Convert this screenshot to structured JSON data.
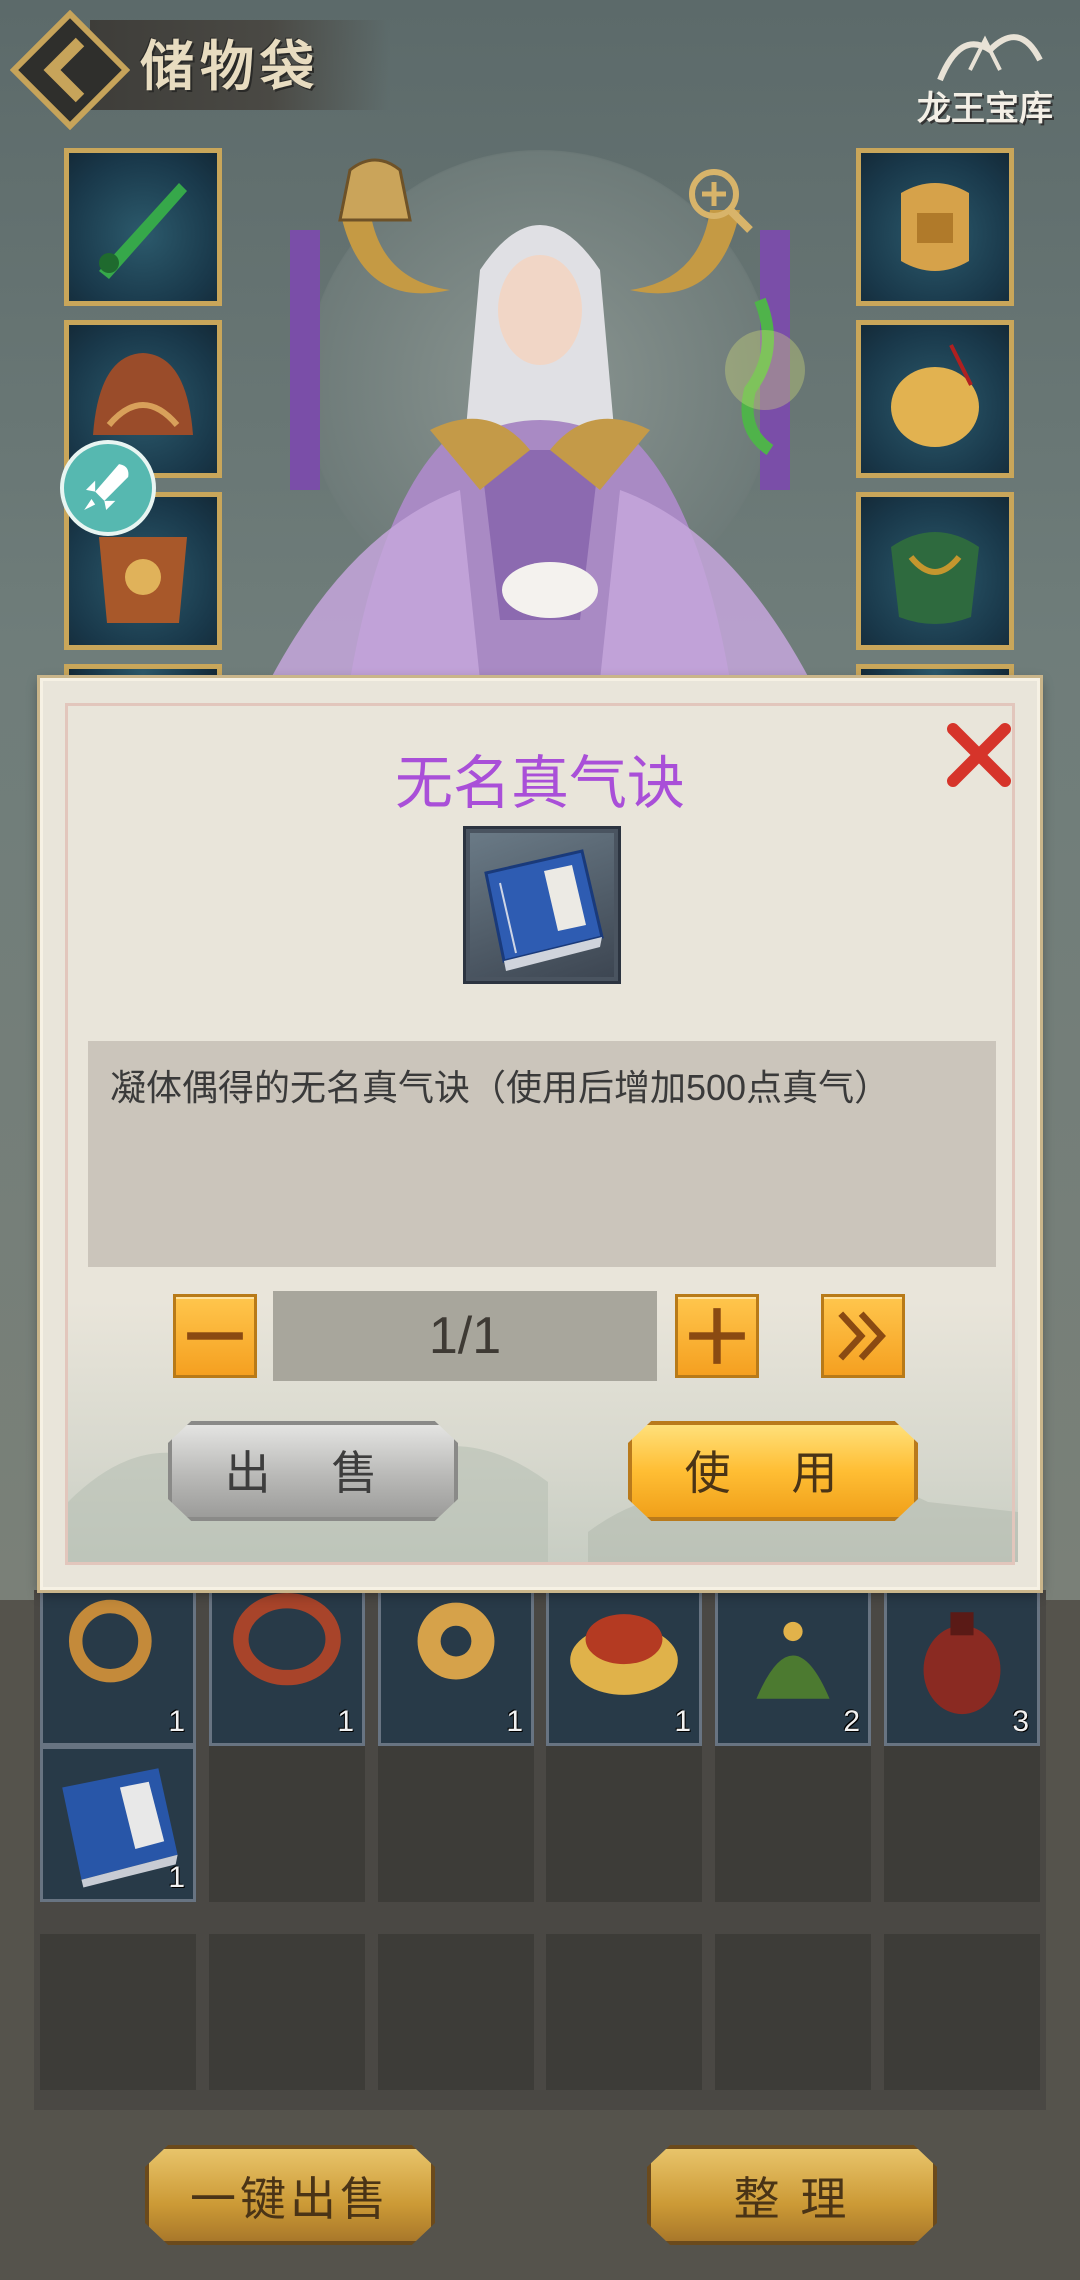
{
  "header": {
    "title": "储物袋",
    "logo_text": "龙王宝库"
  },
  "dialog": {
    "title": "无名真气诀",
    "description": "凝体偶得的无名真气诀（使用后增加500点真气）",
    "quantity": "1/1",
    "sell_label": "出 售",
    "use_label": "使 用"
  },
  "inventory": {
    "row1_counts": [
      "1",
      "1",
      "1",
      "1",
      "2",
      "3"
    ],
    "row2_counts": [
      "1"
    ]
  },
  "footer": {
    "sell_all_label": "一键出售",
    "sort_label": "整 理"
  },
  "colors": {
    "dialog_title": "#a94fd8",
    "gold_button": "#ffbe34",
    "silver_button": "#b9b9b7"
  }
}
